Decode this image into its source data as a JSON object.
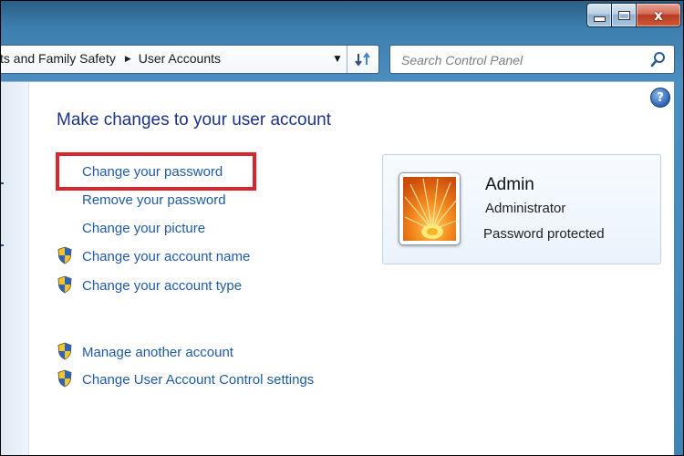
{
  "window": {
    "minimize_icon": "minimize-icon",
    "maximize_icon": "maximize-icon",
    "close_icon": "close-icon",
    "close_glyph": "x"
  },
  "address_bar": {
    "breadcrumb": [
      "ts and Family Safety",
      "User Accounts"
    ],
    "dropdown_icon": "chevron-down-icon",
    "refresh_icon": "refresh-icon"
  },
  "search": {
    "placeholder": "Search Control Panel",
    "icon": "search-icon"
  },
  "help": {
    "icon": "help-icon",
    "glyph": "?"
  },
  "page": {
    "title": "Make changes to your user account"
  },
  "tasks": [
    {
      "label": "Change your password",
      "shield": false
    },
    {
      "label": "Remove your password",
      "shield": false
    },
    {
      "label": "Change your picture",
      "shield": false
    },
    {
      "label": "Change your account name",
      "shield": true
    },
    {
      "label": "Change your account type",
      "shield": true
    },
    {
      "label": "Manage another account",
      "shield": true
    },
    {
      "label": "Change User Account Control settings",
      "shield": true
    }
  ],
  "user": {
    "name": "Admin",
    "type": "Administrator",
    "password_status": "Password protected"
  },
  "colors": {
    "highlight": "#d7262e",
    "link": "#1e5aa8",
    "title": "#1e3287"
  }
}
